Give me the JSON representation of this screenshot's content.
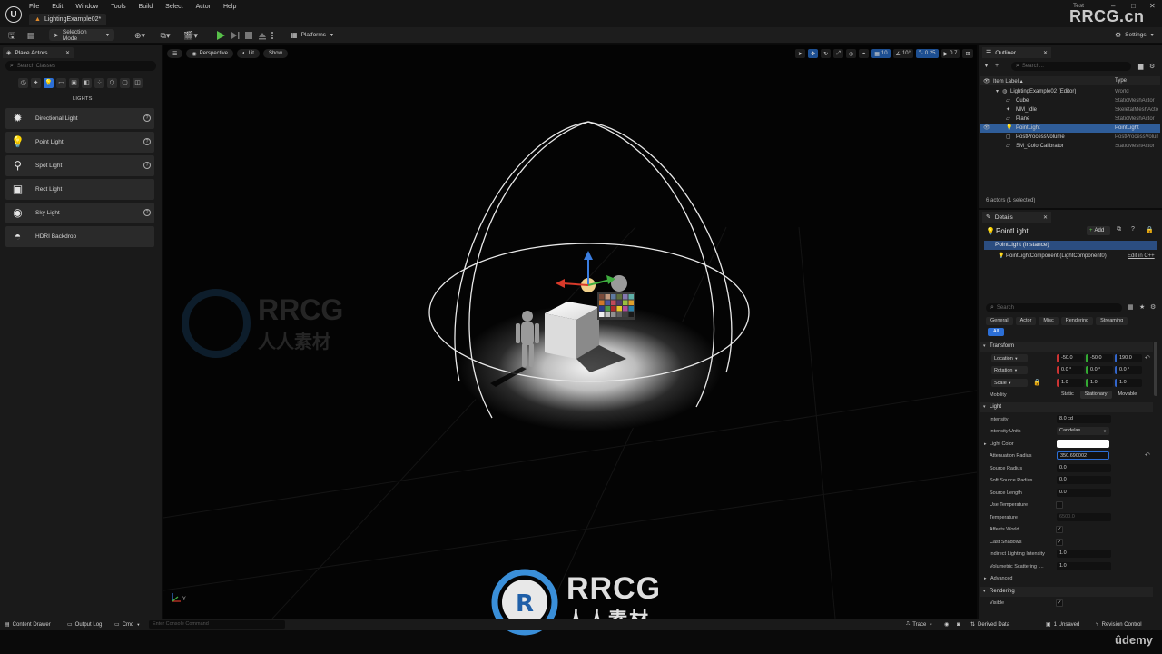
{
  "colors": {
    "accent": "#2c6fd6",
    "selection": "#2f5d99",
    "brand": "#3a8fd9"
  },
  "titlebar": {
    "menu": [
      "File",
      "Edit",
      "Window",
      "Tools",
      "Build",
      "Select",
      "Actor",
      "Help"
    ],
    "level_tab": "LightingExample02*",
    "test_label": "Test",
    "brand": "RRCG.cn"
  },
  "toolbar": {
    "selection_mode": "Selection Mode",
    "platforms": "Platforms",
    "settings": "Settings"
  },
  "place_actors": {
    "tab": "Place Actors",
    "search_placeholder": "Search Classes",
    "heading": "LIGHTS",
    "items": [
      {
        "label": "Directional Light",
        "icon": "directional-light-icon"
      },
      {
        "label": "Point Light",
        "icon": "point-light-icon"
      },
      {
        "label": "Spot Light",
        "icon": "spot-light-icon"
      },
      {
        "label": "Rect Light",
        "icon": "rect-light-icon"
      },
      {
        "label": "Sky Light",
        "icon": "sky-light-icon"
      },
      {
        "label": "HDRI Backdrop",
        "icon": "hdri-backdrop-icon"
      }
    ]
  },
  "viewport": {
    "perspective": "Perspective",
    "lit": "Lit",
    "show": "Show",
    "grid_snap": "10",
    "rot_snap": "10°",
    "scale_snap": "0.25",
    "cam_speed": "0.7"
  },
  "watermark": {
    "brand": "RRCG",
    "sub": "人人素材"
  },
  "outliner": {
    "tab": "Outliner",
    "search_placeholder": "Search...",
    "col_label": "Item Label ▴",
    "col_type": "Type",
    "rows": [
      {
        "name": "LightingExample02 (Editor)",
        "type": "World"
      },
      {
        "name": "Cube",
        "type": "StaticMeshActor"
      },
      {
        "name": "MM_Idle",
        "type": "SkeletalMeshActor"
      },
      {
        "name": "Plane",
        "type": "StaticMeshActor"
      },
      {
        "name": "PointLight",
        "type": "PointLight"
      },
      {
        "name": "PostProcessVolume",
        "type": "PostProcessVolume"
      },
      {
        "name": "SM_ColorCalibrator",
        "type": "StaticMeshActor"
      }
    ],
    "count": "6 actors (1 selected)"
  },
  "details": {
    "tab": "Details",
    "title": "PointLight",
    "add": "Add",
    "instance": "PointLight (Instance)",
    "component": "PointLightComponent (LightComponent0)",
    "edit_cpp": "Edit in C++",
    "search_placeholder": "Search",
    "filters": [
      "General",
      "Actor",
      "Misc",
      "Rendering",
      "Streaming"
    ],
    "filter_all": "All",
    "transform": {
      "header": "Transform",
      "location_label": "Location",
      "location": [
        "-50.0",
        "-50.0",
        "190.0"
      ],
      "rotation_label": "Rotation",
      "rotation": [
        "0.0 °",
        "0.0 °",
        "0.0 °"
      ],
      "scale_label": "Scale",
      "scale": [
        "1.0",
        "1.0",
        "1.0"
      ],
      "mobility_label": "Mobility",
      "mobility": [
        "Static",
        "Stationary",
        "Movable"
      ]
    },
    "light": {
      "header": "Light",
      "intensity_label": "Intensity",
      "intensity": "8.0 cd",
      "intensity_units_label": "Intensity Units",
      "intensity_units": "Candelas",
      "light_color_label": "Light Color",
      "attenuation_label": "Attenuation Radius",
      "attenuation": "350.690002",
      "source_radius_label": "Source Radius",
      "source_radius": "0.0",
      "soft_source_label": "Soft Source Radius",
      "soft_source": "0.0",
      "source_length_label": "Source Length",
      "source_length": "0.0",
      "use_temp_label": "Use Temperature",
      "temperature_label": "Temperature",
      "temperature": "6500.0",
      "affects_world_label": "Affects World",
      "cast_shadows_label": "Cast Shadows",
      "indirect_label": "Indirect Lighting Intensity",
      "indirect": "1.0",
      "volumetric_label": "Volumetric Scattering I...",
      "volumetric": "1.0"
    },
    "advanced": "Advanced",
    "rendering": {
      "header": "Rendering",
      "visible_label": "Visible"
    }
  },
  "statusbar": {
    "content_drawer": "Content Drawer",
    "output_log": "Output Log",
    "cmd": "Cmd",
    "console_placeholder": "Enter Console Command",
    "trace": "Trace",
    "derived_data": "Derived Data",
    "unsaved": "1 Unsaved",
    "revision_control": "Revision Control"
  },
  "udemy": "ûdemy"
}
